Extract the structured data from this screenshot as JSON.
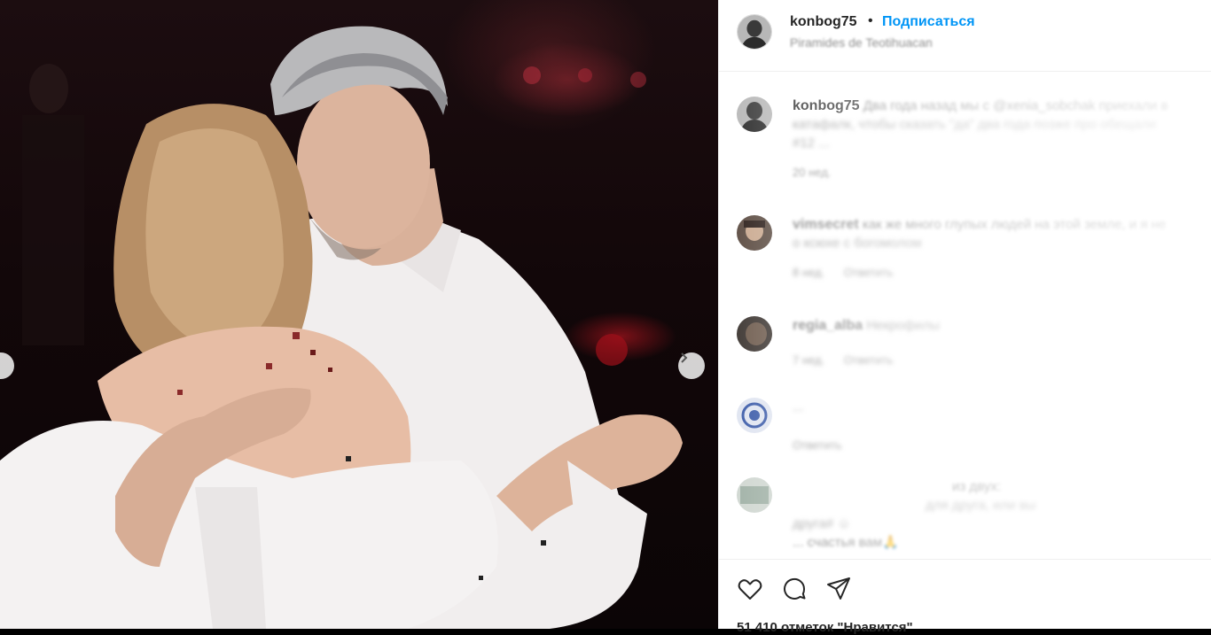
{
  "post": {
    "author": "konbog75",
    "follow_label": "Подписаться",
    "separator": "•",
    "location": "Piramides de Teotihuacan"
  },
  "caption": {
    "username": "konbog75",
    "text_visible": "Два года назад мы с",
    "mention": "@xenia_sobchak",
    "text_blurred_1": "приехали в",
    "line2": "катафалк, чтобы сказать \"да\" два года позже про обещали",
    "line3": "#12 ...",
    "age": "20 нед."
  },
  "comments": [
    {
      "username": "vimsecret",
      "text": "как же много глупых людей на этой земле, и я не",
      "text_line2": "о ксюхе с богомолом",
      "age": "8 нед.",
      "reply_label": "Ответить"
    },
    {
      "username": "regia_alba",
      "text": "Некрофилы",
      "age": "7 нед.",
      "reply_label": "Ответить"
    },
    {
      "username": "",
      "text": "...",
      "age": "",
      "reply_label": "Ответить"
    },
    {
      "username": "",
      "text_line1": "из двух:",
      "text_line2": "для друга, или вы",
      "text_line3": "друга# ☺",
      "text_line4": "... счастья вам🙏"
    }
  ],
  "actions": {
    "like_icon": "heart-icon",
    "comment_icon": "comment-icon",
    "share_icon": "share-icon"
  },
  "likes_text": "51 410 отметок \"Нравится\""
}
